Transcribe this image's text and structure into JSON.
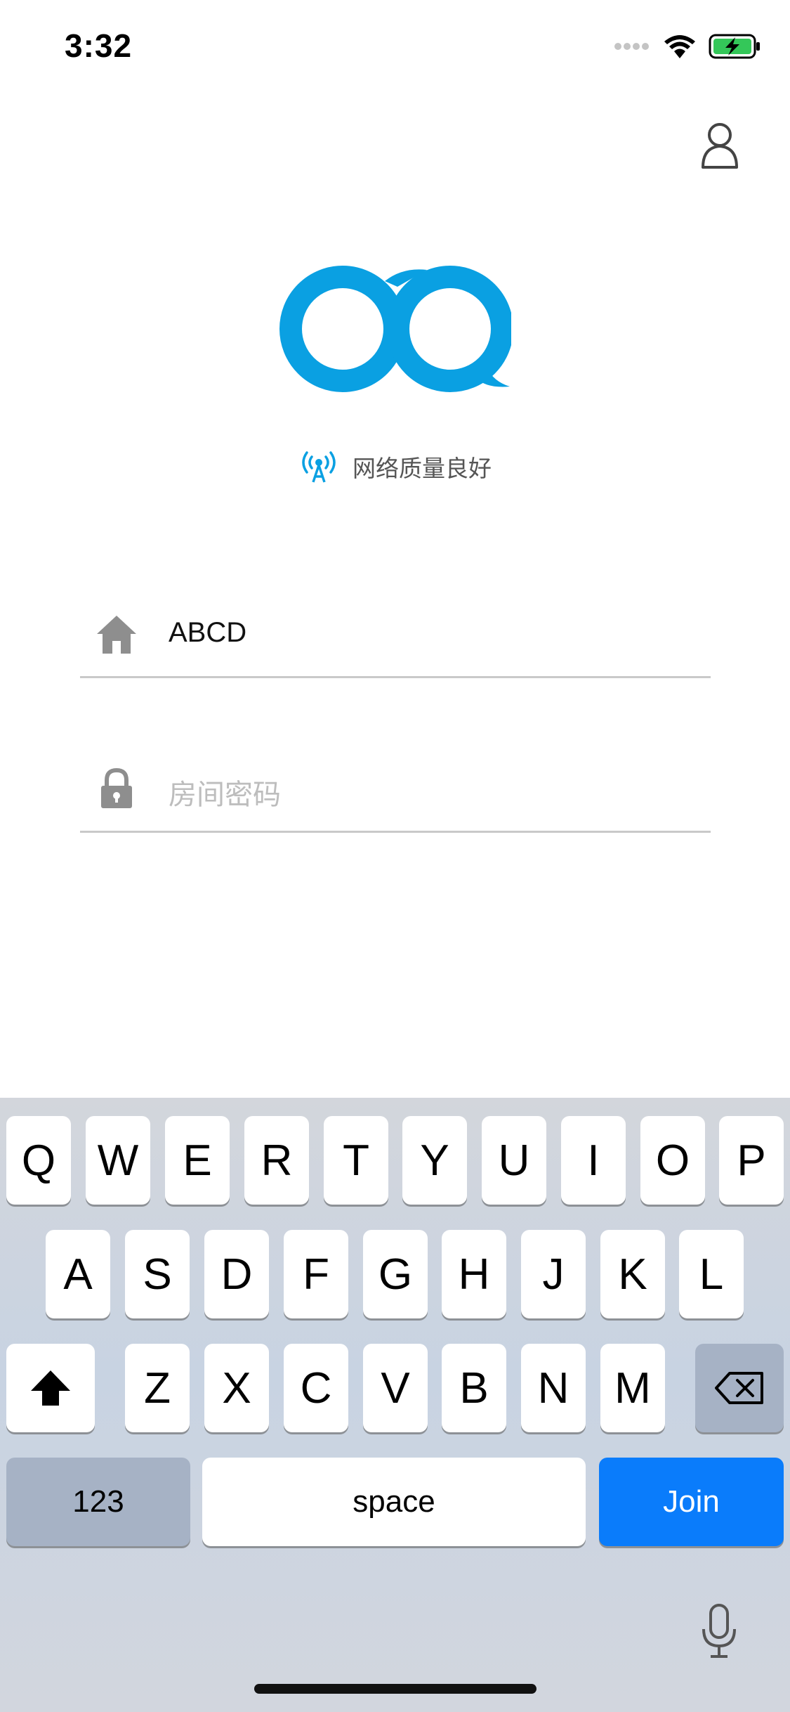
{
  "status_bar": {
    "time": "3:32"
  },
  "network": {
    "status_text": "网络质量良好"
  },
  "room_field": {
    "value": "ABCD"
  },
  "password_field": {
    "placeholder": "房间密码"
  },
  "keyboard": {
    "row1": [
      "Q",
      "W",
      "E",
      "R",
      "T",
      "Y",
      "U",
      "I",
      "O",
      "P"
    ],
    "row2": [
      "A",
      "S",
      "D",
      "F",
      "G",
      "H",
      "J",
      "K",
      "L"
    ],
    "row3": [
      "Z",
      "X",
      "C",
      "V",
      "B",
      "N",
      "M"
    ],
    "numbers_label": "123",
    "space_label": "space",
    "join_label": "Join"
  },
  "colors": {
    "brand": "#0aa0e2",
    "join_key": "#0a7cfb",
    "battery": "#34c759"
  },
  "icons": [
    "signal-dots-icon",
    "wifi-icon",
    "battery-charging-icon",
    "person-icon",
    "broadcast-icon",
    "house-icon",
    "lock-icon",
    "shift-icon",
    "backspace-icon",
    "microphone-icon"
  ]
}
